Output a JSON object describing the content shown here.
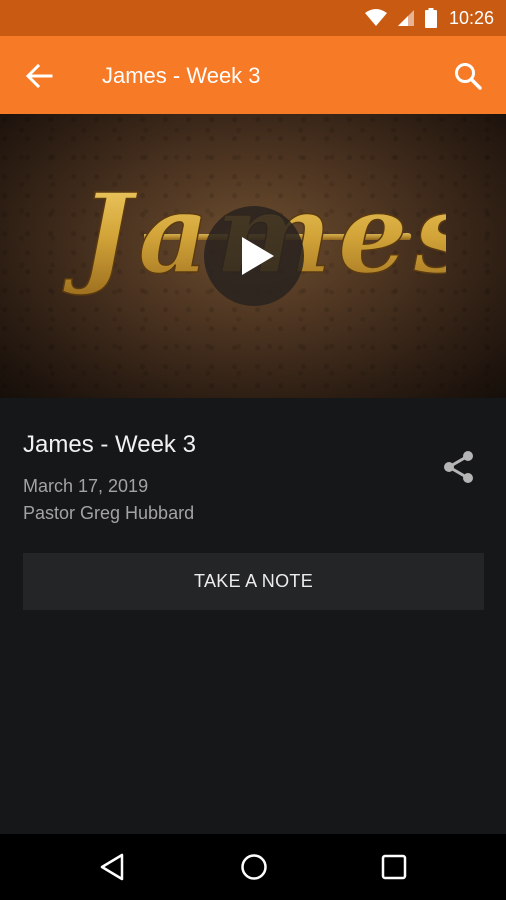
{
  "status_bar": {
    "time": "10:26",
    "icons": [
      "wifi-icon",
      "signal-icon",
      "battery-icon"
    ]
  },
  "app_bar": {
    "title": "James - Week 3",
    "icons": [
      "back-arrow-icon",
      "search-icon"
    ],
    "color": "#f77a26"
  },
  "video": {
    "artwork_title": "James",
    "icons": [
      "play-icon"
    ]
  },
  "sermon": {
    "title": "James - Week 3",
    "date": "March 17, 2019",
    "speaker": "Pastor Greg Hubbard",
    "share_icon": "share-icon"
  },
  "actions": {
    "take_note_label": "TAKE A NOTE"
  },
  "nav_bar": {
    "icons": [
      "back-triangle-icon",
      "home-circle-icon",
      "recents-square-icon"
    ]
  }
}
